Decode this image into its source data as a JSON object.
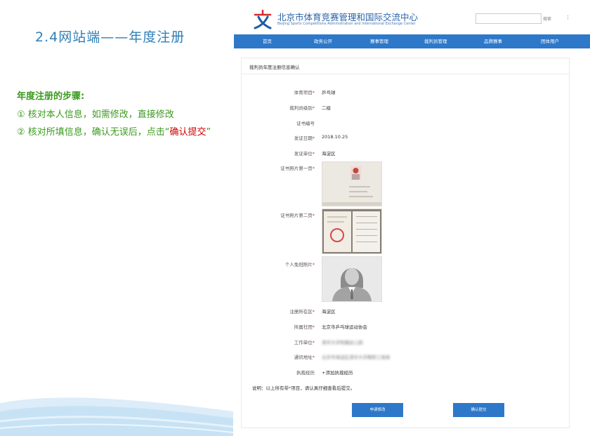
{
  "slide": {
    "title": "2.4网站端——年度注册",
    "steps_heading": "年度注册的步骤:",
    "step1": "① 核对本人信息，如需修改，直接修改",
    "step2_prefix": "② 核对所填信息，确认无误后，点击“",
    "step2_highlight": "确认提交",
    "step2_suffix": "”"
  },
  "site": {
    "name_cn": "北京市体育竞赛管理和国际交流中心",
    "name_en": "Beijing Sports Competitions Administration and International Exchange Center",
    "search_label": "搜索",
    "more_label": "⋮",
    "logo_icon": "sports-center-logo"
  },
  "nav": [
    "首页",
    "政务公开",
    "赛事管理",
    "裁判员管理",
    "品牌赛事",
    "团体用户"
  ],
  "form": {
    "title": "裁判员年度注册信息确认",
    "fields": [
      {
        "label": "体育项目",
        "required": "*",
        "value": "乒乓球"
      },
      {
        "label": "裁判员级别",
        "required": "*",
        "value": "二级"
      },
      {
        "label": "证书编号",
        "required": "",
        "value": ""
      },
      {
        "label": "发证日期",
        "required": "*",
        "value": "2018.10.25"
      },
      {
        "label": "发证单位",
        "required": "*",
        "value": "海淀区"
      },
      {
        "label": "证书照片第一页",
        "required": "*"
      },
      {
        "label": "证书照片第二页",
        "required": "*"
      },
      {
        "label": "个人免冠照片",
        "required": "*"
      },
      {
        "label": "注册所在区",
        "required": "*",
        "value": "海淀区"
      },
      {
        "label": "所属社团",
        "required": "*",
        "value": "北京市乒乓球运动协会"
      },
      {
        "label": "工作单位",
        "required": "*",
        "value": "清华大学附属幼儿园"
      },
      {
        "label": "通讯地址",
        "required": "*",
        "value": "北京市海淀区清华大学教职工宿舍"
      },
      {
        "label": "执裁经历",
        "required": "",
        "value": "+添加执裁经历"
      }
    ],
    "note_prefix": "说明：以上所有带",
    "note_star": "*",
    "note_suffix": "项目，请认真仔细查看后提交。",
    "apply_button": "申请修改",
    "confirm_button": "确认提交"
  },
  "colors": {
    "nav": "#2d78c9",
    "title": "#2f7fb6",
    "steps": "#3b9a1f",
    "highlight": "#d40000"
  }
}
